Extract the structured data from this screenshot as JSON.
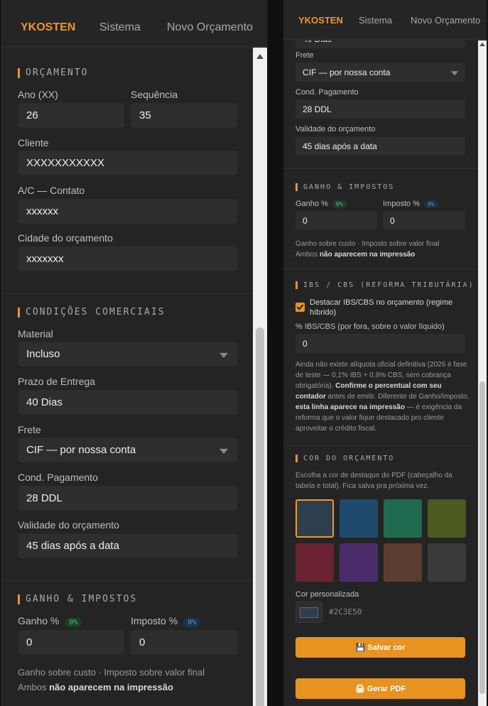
{
  "nav": {
    "brand": "YKOSTEN",
    "link1": "Sistema",
    "link2": "Novo Orçamento"
  },
  "orcamento": {
    "title": "ORÇAMENTO",
    "ano_label": "Ano (XX)",
    "ano_value": "26",
    "seq_label": "Sequência",
    "seq_value": "35",
    "cliente_label": "Cliente",
    "cliente_value": "XXXXXXXXXXX",
    "contato_label": "A/C — Contato",
    "contato_value": "xxxxxx",
    "cidade_label": "Cidade do orçamento",
    "cidade_value": "xxxxxxx"
  },
  "comerciais": {
    "title": "CONDIÇÕES COMERCIAIS",
    "material_label": "Material",
    "material_value": "Incluso",
    "prazo_label": "Prazo de Entrega",
    "prazo_value": "40 Dias",
    "frete_label": "Frete",
    "frete_value": "CIF — por nossa conta",
    "pagamento_label": "Cond. Pagamento",
    "pagamento_value": "28 DDL",
    "validade_label": "Validade do orçamento",
    "validade_value": "45 dias após a data",
    "partial_top": "40 Dias"
  },
  "impostos": {
    "title": "GANHO & IMPOSTOS",
    "ganho_label": "Ganho %",
    "ganho_badge": "0%",
    "ganho_value": "0",
    "imposto_label": "Imposto %",
    "imposto_badge": "0%",
    "imposto_value": "0",
    "note_line1": "Ganho sobre custo · Imposto sobre valor final",
    "note_prefix": "Ambos ",
    "note_bold": "não aparecem na impressão"
  },
  "ibs": {
    "title": "IBS / CBS (REFORMA TRIBUTÁRIA)",
    "checkbox_label": "Destacar IBS/CBS no orçamento (regime híbrido)",
    "checked": true,
    "pct_label": "% IBS/CBS (por fora, sobre o valor líquido)",
    "pct_value": "0",
    "note_a": "Ainda não existe alíquota oficial definitiva (2026 é fase de teste — 0,1% IBS + 0,9% CBS, sem cobrança obrigatória). ",
    "note_b": "Confirme o percentual com seu contador",
    "note_c": " antes de emitir. Diferente de Ganho/Imposto, ",
    "note_d": "esta linha aparece na impressão",
    "note_e": " — é exigência da reforma que o valor fique destacado pro cliente aproveitar o crédito fiscal."
  },
  "cor": {
    "title": "COR DO ORÇAMENTO",
    "description": "Escolha a cor de destaque do PDF (cabeçalho da tabela e total). Fica salva pra próxima vez.",
    "swatches": [
      "#2c3e50",
      "#1f4a6b",
      "#1e6b50",
      "#4a5a20",
      "#6b2233",
      "#4a2c6b",
      "#5a3d2e",
      "#3a3a3a"
    ],
    "selected_index": 0,
    "custom_label": "Cor personalizada",
    "custom_value": "#2C3E50",
    "save_button": "💾 Salvar cor",
    "pdf_button": "🖨 Gerar PDF"
  }
}
